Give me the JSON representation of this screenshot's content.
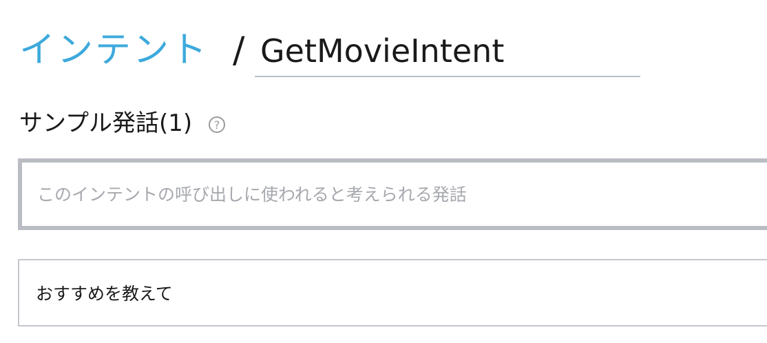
{
  "header": {
    "breadcrumb_label": "インテント",
    "separator": "/",
    "intent_name": "GetMovieIntent"
  },
  "sample_utterances": {
    "title": "サンプル発話(1)",
    "help_icon": "question-circle-icon",
    "input_placeholder": "このインテントの呼び出しに使われると考えられる発話",
    "items": [
      {
        "text": "おすすめを教えて"
      }
    ]
  }
}
